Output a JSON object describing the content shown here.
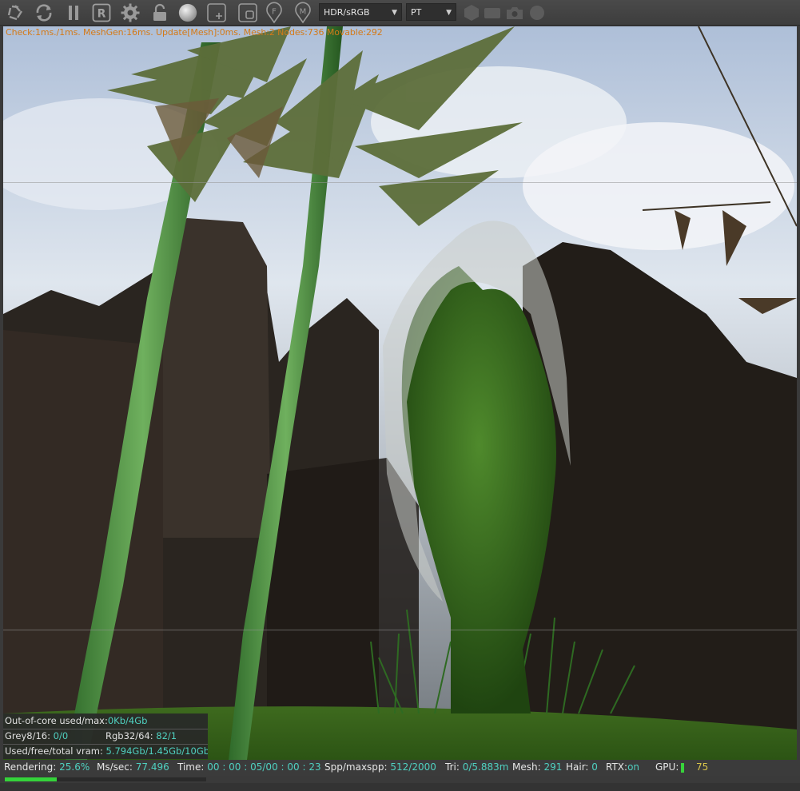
{
  "toolbar": {
    "icons": [
      "aperture-icon",
      "refresh-icon",
      "pause-icon",
      "r-icon",
      "gear-icon",
      "lock-icon",
      "sphere-icon",
      "add-region-icon",
      "region-icon",
      "focus-pin-icon",
      "material-pin-icon"
    ],
    "colorspace_value": "HDR/sRGB",
    "kernel_value": "PT",
    "disabled_icons": [
      "hexagon-icon",
      "rect-icon",
      "camera-icon",
      "circle-icon"
    ]
  },
  "viewport": {
    "stats_line": "Check:1ms./1ms. MeshGen:16ms. Update[Mesh]:0ms. Mesh:2 Nodes:736 Movable:292"
  },
  "memory": {
    "out_of_core_label": "Out-of-core used/max:",
    "out_of_core_value": "0Kb/4Gb",
    "grey_label": "Grey8/16: ",
    "grey_value": "0/0",
    "rgb_label": "Rgb32/64: ",
    "rgb_value": "82/1",
    "vram_label": "Used/free/total vram: ",
    "vram_value": "5.794Gb/1.45Gb/10Gb"
  },
  "status": {
    "rendering_label": "Rendering: ",
    "rendering_value": "25.6%",
    "ms_label": "Ms/sec: ",
    "ms_value": "77.496",
    "time_label": "Time: ",
    "time_value": "00 : 00 : 05/00 : 00 : 23",
    "spp_label": "Spp/maxspp: ",
    "spp_value": "512/2000",
    "tri_label": "Tri: ",
    "tri_value": "0/5.883m",
    "mesh_label": "Mesh: ",
    "mesh_value": "291",
    "hair_label": "Hair: ",
    "hair_value": "0",
    "rtx_label": "RTX:",
    "rtx_value": "on",
    "gpu_label": "GPU:",
    "gpu_value": "75",
    "progress_fraction": 0.256
  },
  "colors": {
    "accent_value": "#4fd0c0",
    "stats_text": "#d47a18",
    "progress": "#34d33a",
    "gpu_value": "#d7c34a"
  }
}
